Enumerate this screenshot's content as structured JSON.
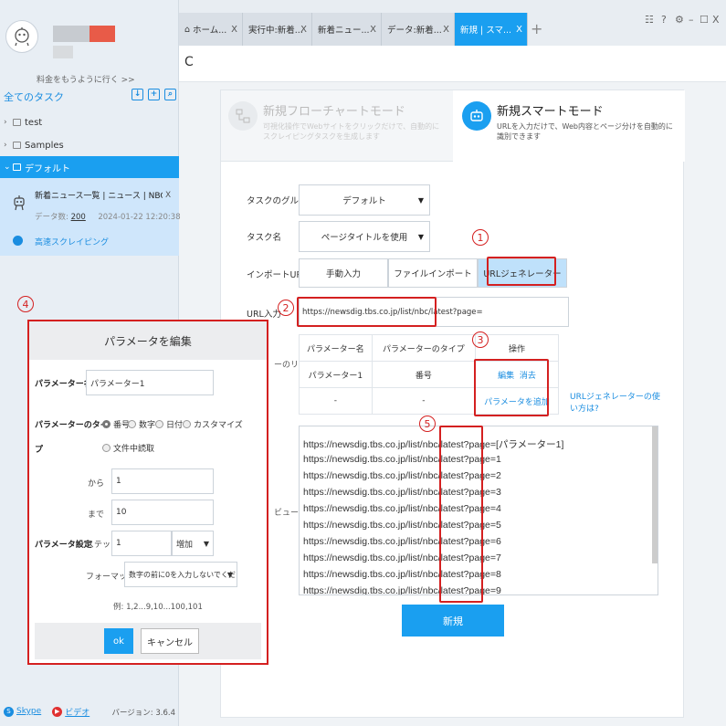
{
  "sidebar": {
    "upgrade_link": "料金をもうように行く >>",
    "all_tasks": "全てのタスク",
    "tree": [
      {
        "label": "test"
      },
      {
        "label": "Samples"
      },
      {
        "label": "デフォルト"
      }
    ],
    "task": {
      "name": "新着ニュース一覧 | ニュース | NBC長崎放送...",
      "close": "X",
      "data_label": "データ数:",
      "data_count": "200",
      "timestamp": "2024-01-22 12:20:38",
      "hs_label": "高速スクレイピング"
    },
    "footer": {
      "skype": "Skype",
      "video": "ビデオ",
      "version": "バージョン: 3.6.4"
    }
  },
  "tabs": [
    {
      "label": "ホーム...",
      "close": "X"
    },
    {
      "label": "実行中:新着...",
      "close": "X"
    },
    {
      "label": "新着ニュー...",
      "close": "X"
    },
    {
      "label": "データ:新着...",
      "close": "X"
    },
    {
      "label": "新規 | スマ...",
      "close": "X"
    }
  ],
  "tab_add": "+",
  "window_controls": {
    "grid": "☷",
    "help": "?",
    "settings": "⚙",
    "minimize": "–",
    "maximize": "☐",
    "close": "X"
  },
  "toolbar": {
    "reload": "C"
  },
  "modes": {
    "flow": {
      "title": "新規フローチャートモード",
      "desc": "可視化操作でWebサイトをクリックだけで、自動的にスクレイピングタスクを生成します"
    },
    "smart": {
      "title": "新規スマートモード",
      "desc": "URLを入力だけで、Web内容とページ分けを自動的に識別できます"
    }
  },
  "form": {
    "group_label": "タスクのグループ",
    "group_value": "デフォルト",
    "name_label": "タスク名",
    "name_value": "ページタイトルを使用",
    "import_label": "インポートURL",
    "import_manual": "手動入力",
    "import_file": "ファイルインポート",
    "import_generator": "URLジェネレーター",
    "url_label": "URL入力",
    "url_value": "https://newsdig.tbs.co.jp/list/nbc/latest?page=",
    "param_side_label": "ーのリ",
    "param_headers": [
      "パラメーター名",
      "パラメーターのタイプ",
      "操作"
    ],
    "param_rows": [
      {
        "name": "パラメーター1",
        "type": "番号",
        "edit": "編集",
        "delete": "消去"
      },
      {
        "name": "-",
        "type": "-",
        "add": "パラメータを追加"
      }
    ],
    "help_link": "URLジェネレーターの使い方は?",
    "preview_label": "ビュー",
    "preview_lines": [
      "https://newsdig.tbs.co.jp/list/nbc/latest?page=[パラメーター1]",
      "https://newsdig.tbs.co.jp/list/nbc/latest?page=1",
      "https://newsdig.tbs.co.jp/list/nbc/latest?page=2",
      "https://newsdig.tbs.co.jp/list/nbc/latest?page=3",
      "https://newsdig.tbs.co.jp/list/nbc/latest?page=4",
      "https://newsdig.tbs.co.jp/list/nbc/latest?page=5",
      "https://newsdig.tbs.co.jp/list/nbc/latest?page=6",
      "https://newsdig.tbs.co.jp/list/nbc/latest?page=7",
      "https://newsdig.tbs.co.jp/list/nbc/latest?page=8",
      "https://newsdig.tbs.co.jp/list/nbc/latest?page=9"
    ],
    "create_button": "新規"
  },
  "annotations": [
    "1",
    "2",
    "3",
    "4",
    "5"
  ],
  "dialog": {
    "title": "パラメータを編集",
    "name_label": "パラメーター名",
    "name_value": "パラメーター1",
    "type_label": "パラメーターのタイ",
    "type_label2": "プ",
    "types": [
      "番号",
      "数字",
      "日付",
      "カスタマイズ",
      "文件中読取"
    ],
    "from_label": "から",
    "from_value": "1",
    "to_label": "まで",
    "to_value": "10",
    "settings_label": "パラメータ設定",
    "step_label": "ステップ",
    "step_value": "1",
    "step_mode": "増加",
    "format_label": "フォーマット",
    "format_value": "数字の前に0を入力しないでください",
    "example": "例: 1,2...9,10...100,101",
    "ok": "ok",
    "cancel": "キャンセル"
  },
  "colors": {
    "accent": "#1a9ff0",
    "annotation": "#d42020",
    "active_tab": "#1a9ff0"
  }
}
